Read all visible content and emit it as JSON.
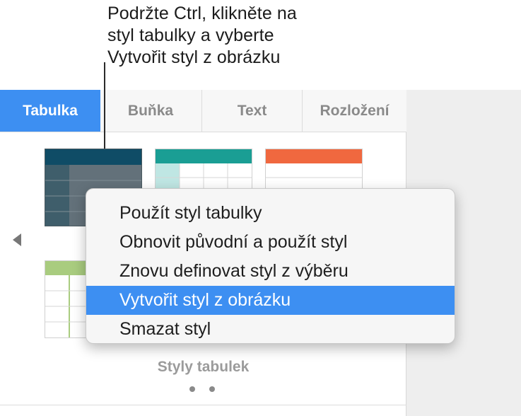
{
  "callout": {
    "line1": "Podržte Ctrl, klikněte na",
    "line2": "styl tabulky a vyberte",
    "line3": "Vytvořit styl z obrázku"
  },
  "tabs": [
    {
      "label": "Tabulka",
      "active": true
    },
    {
      "label": "Buňka",
      "active": false
    },
    {
      "label": "Text",
      "active": false
    },
    {
      "label": "Rozložení",
      "active": false
    }
  ],
  "context_menu": {
    "items": [
      {
        "label": "Použít styl tabulky"
      },
      {
        "label": "Obnovit původní a použít styl"
      },
      {
        "label": "Znovu definovat styl z výběru"
      },
      {
        "label": "Vytvořit styl z obrázku",
        "selected": true
      },
      {
        "label": "Smazat styl"
      }
    ]
  },
  "footer": {
    "label": "Styly tabulek",
    "page_count": 2
  },
  "colors": {
    "accent": "#3d8ff2",
    "style_dark": "#0f4c66",
    "style_teal": "#1a9e94",
    "style_orange": "#f0683f",
    "style_green": "#a9cc7f"
  }
}
